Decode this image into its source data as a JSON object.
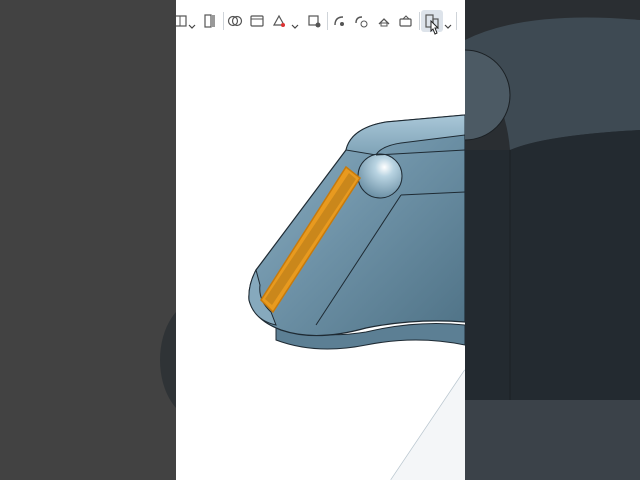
{
  "app": {
    "toolbar": {
      "tools": [
        {
          "name": "view-cube-icon"
        },
        {
          "name": "section-view-icon"
        },
        {
          "name": "transparency-icon"
        },
        {
          "name": "display-mode-icon"
        },
        {
          "name": "appearance-icon"
        },
        {
          "name": "hide-icon"
        },
        {
          "name": "measure-icon"
        },
        {
          "name": "mass-properties-icon"
        },
        {
          "name": "explode-icon"
        },
        {
          "name": "camera-icon"
        },
        {
          "name": "named-views-icon"
        }
      ]
    },
    "model": {
      "body_color": "#6f93a8",
      "highlight_color": "#f0a325",
      "edge_color": "#1e2a33",
      "selected_face": "highlighted-edge-face"
    }
  }
}
